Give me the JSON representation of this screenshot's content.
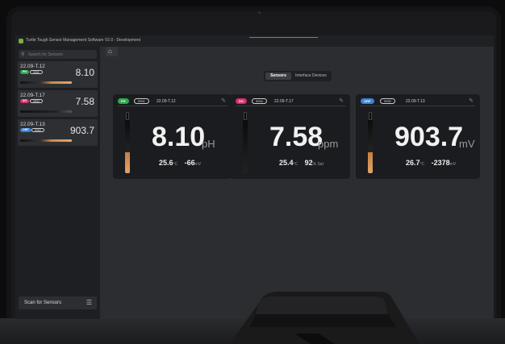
{
  "window": {
    "title": "Turtle Tough Sensor Management Software V2.0 - Development"
  },
  "sidebar": {
    "search_placeholder": "Search for Sensors",
    "cards": [
      {
        "name": "22.09-T.12",
        "badge": "PH",
        "badge_color": "#2fa84f",
        "id": "9991",
        "value": "8.10"
      },
      {
        "name": "22.09-T.17",
        "badge": "DO",
        "badge_color": "#d62f6b",
        "id": "9994",
        "value": "7.58"
      },
      {
        "name": "22.09-T.13",
        "badge": "ORP",
        "badge_color": "#3a82d6",
        "id": "9992",
        "value": "903.7"
      }
    ],
    "scan_label": "Scan for Sensors"
  },
  "tabs": {
    "sensors": "Sensors",
    "interface": "Interface Devices"
  },
  "sensors": [
    {
      "badge": "PH",
      "badge_color": "#2fa84f",
      "id": "9991",
      "name": "22.09-T.12",
      "value": "8.10",
      "unit": "pH",
      "temp": "25.6",
      "temp_unit": "°C",
      "sec": "-66",
      "sec_unit": "mV"
    },
    {
      "badge": "DO",
      "badge_color": "#d62f6b",
      "id": "9994",
      "name": "22.09-T.17",
      "value": "7.58",
      "unit": "ppm",
      "temp": "25.4",
      "temp_unit": "°C",
      "sec": "92",
      "sec_unit": "% Sat"
    },
    {
      "badge": "ORP",
      "badge_color": "#3a82d6",
      "id": "9992",
      "name": "22.09-T.13",
      "value": "903.7",
      "unit": "mV",
      "temp": "26.7",
      "temp_unit": "°C",
      "sec": "-2378",
      "sec_unit": "mV"
    }
  ]
}
